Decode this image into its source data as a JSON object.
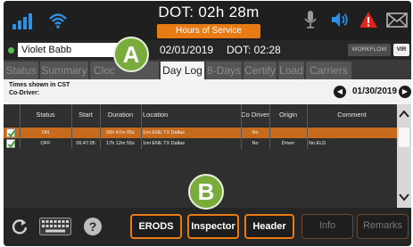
{
  "topbar": {
    "dot_clock": "DOT: 02h 28m",
    "hos_badge": "Hours of Service"
  },
  "driver": {
    "name": "Violet Babb",
    "date": "02/01/2019",
    "dot_time": "DOT: 02:28",
    "workflow_label": "WORKFLOW",
    "vir_label": "VIR"
  },
  "tabs": [
    {
      "label": "Status"
    },
    {
      "label": "Summary"
    },
    {
      "label": "Cloc"
    },
    {
      "label": "Day Log"
    },
    {
      "label": "8-Days"
    },
    {
      "label": "Certify"
    },
    {
      "label": "Load"
    },
    {
      "label": "Carriers"
    }
  ],
  "info": {
    "times_shown": "Times shown in CST",
    "co_driver": "Co-Driver:",
    "log_date": "01/30/2019",
    "prev_glyph": "◀",
    "next_glyph": "▶"
  },
  "table": {
    "headers": {
      "status": "Status",
      "start": "Start",
      "duration": "Duration",
      "location": "Location",
      "co_driver": "Co Driver",
      "origin": "Origin",
      "comment": "Comment"
    },
    "rows": [
      {
        "status": "ON",
        "start": "",
        "duration": "06h 47m 05s",
        "location": "1mi ENE TX Dallas",
        "co_driver": "No",
        "origin": "",
        "comment": ""
      },
      {
        "status": "OFF",
        "start": "06:47:05",
        "duration": "17h 12m 55s",
        "location": "1mi ENE TX Dallas",
        "co_driver": "No",
        "origin": "Driver",
        "comment": "No ELD"
      }
    ]
  },
  "bottom": {
    "erods": "ERODS",
    "inspector": "Inspector",
    "header": "Header",
    "info": "Info",
    "remarks": "Remarks",
    "help_glyph": "?"
  },
  "callouts": {
    "a": "A",
    "b": "B"
  },
  "colors": {
    "accent_orange": "#e87b14",
    "selected_row": "#c66a1e",
    "callout_green": "#79ac3c",
    "signal_blue": "#2f8fe0",
    "alert_red": "#e0251b"
  },
  "icons": [
    "signal-icon",
    "wifi-icon",
    "microphone-icon",
    "speaker-icon",
    "alert-icon",
    "mail-icon",
    "refresh-icon",
    "keyboard-icon",
    "help-icon",
    "scroll-up-icon",
    "scroll-down-icon",
    "prev-day-icon",
    "next-day-icon",
    "check-icon"
  ]
}
